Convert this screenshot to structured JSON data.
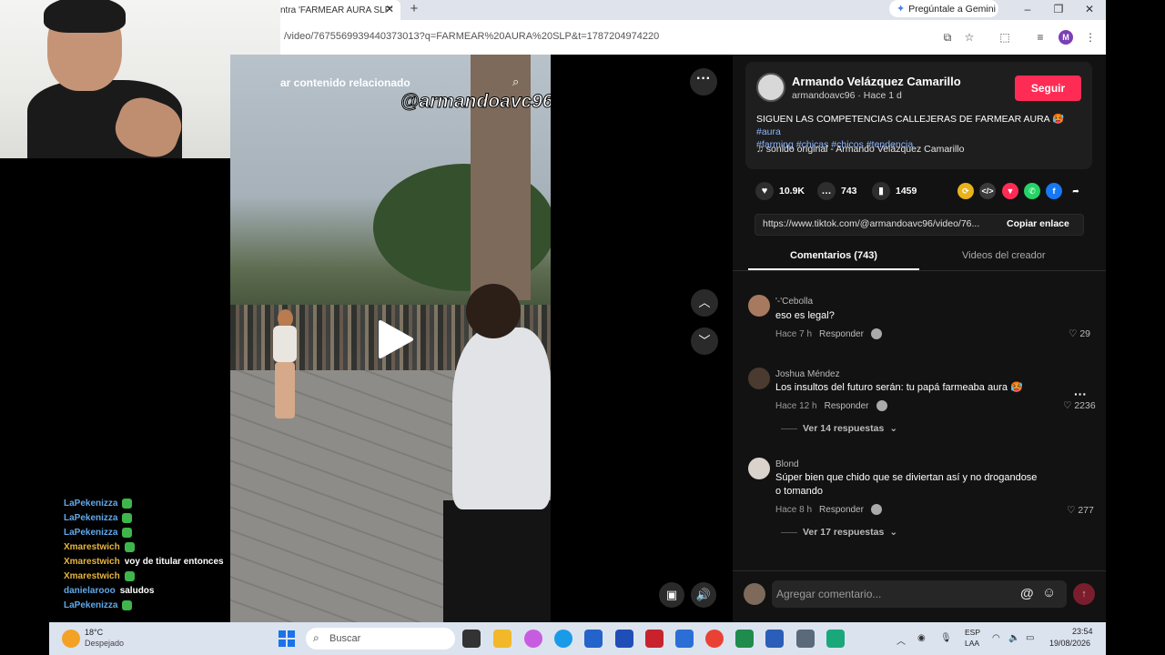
{
  "browser": {
    "tab_title": "ntra 'FARMEAR AURA SLP'",
    "tab_close": "✕",
    "new_tab": "+",
    "gemini_label": "Pregúntale a Gemini",
    "url": "/video/7675569939440373013?q=FARMEAR%20AURA%20SLP&t=1787204974220",
    "profile_initial": "M"
  },
  "chat": {
    "lines": [
      {
        "user": "LaPekenizza",
        "msg": "",
        "user_color": "#61a8ea"
      },
      {
        "user": "LaPekenizza",
        "msg": "",
        "user_color": "#61a8ea"
      },
      {
        "user": "LaPekenizza",
        "msg": "",
        "user_color": "#61a8ea"
      },
      {
        "user": "Xmarestwich",
        "msg": "",
        "user_color": "#e6b640"
      },
      {
        "user": "Xmarestwich",
        "msg": "voy de titular entonces",
        "user_color": "#e6b640"
      },
      {
        "user": "Xmarestwich",
        "msg": "",
        "user_color": "#e6b640"
      },
      {
        "user": "danielarooo",
        "msg": "saludos",
        "user_color": "#61a8ea"
      },
      {
        "user": "LaPekenizza",
        "msg": "",
        "user_color": "#61a8ea"
      }
    ]
  },
  "video": {
    "search_placeholder": "ar contenido relacionado",
    "watermark": "@armandoavc96"
  },
  "post": {
    "author_name": "Armando Velázquez Camarillo",
    "author_sub": "armandoavc96 · Hace 1 d",
    "follow_label": "Seguir",
    "description": "SIGUEN LAS COMPETENCIAS CALLEJERAS DE FARMEAR AURA",
    "tags_line1": "#aura",
    "tags_line2": "#farming #chicas #chicos #tendencia",
    "sound": "sonido original - Armando Velázquez Camarillo",
    "likes": "10.9K",
    "comments": "743",
    "saves": "1459",
    "link": "https://www.tiktok.com/@armandoavc96/video/76...",
    "copy_label": "Copiar enlace",
    "tab_comments": "Comentarios (743)",
    "tab_creator": "Videos del creador"
  },
  "comments": [
    {
      "user": "'-'Cebolla",
      "text": "eso es legal?",
      "time": "Hace 7 h",
      "reply": "Responder",
      "likes": "29"
    },
    {
      "user": "Joshua Méndez",
      "text": "Los insultos del futuro serán: tu papá farmeaba aura",
      "time": "Hace 12 h",
      "reply": "Responder",
      "likes": "2236",
      "replies": "Ver 14 respuestas"
    },
    {
      "user": "Blond",
      "text": "Súper bien  que chido que se diviertan así y no drogandose o tomando",
      "time": "Hace 8 h",
      "reply": "Responder",
      "likes": "277",
      "replies": "Ver 17 respuestas"
    }
  ],
  "comment_bar": {
    "placeholder": "Agregar comentario...",
    "at": "@",
    "emoji": "☺"
  },
  "taskbar": {
    "temp": "18°C",
    "weather": "Despejado",
    "search": "Buscar",
    "lang1": "ESP",
    "lang2": "LAA",
    "time": "23:54",
    "date": "19/08/2026"
  }
}
